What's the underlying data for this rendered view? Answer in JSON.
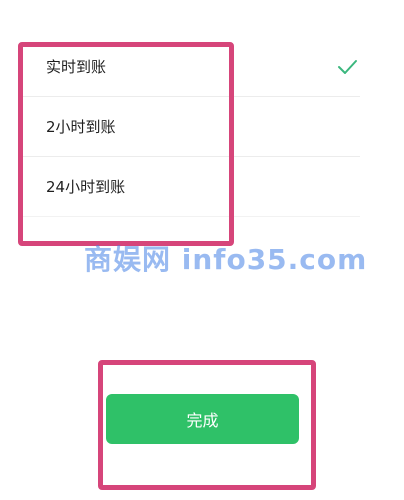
{
  "options": [
    {
      "label": "实时到账",
      "selected": true
    },
    {
      "label": "2小时到账",
      "selected": false
    },
    {
      "label": "24小时到账",
      "selected": false
    }
  ],
  "check_icon": "checkmark-icon",
  "watermark_text": "商娱网 info35.com",
  "done_button_label": "完成",
  "colors": {
    "accent_green": "#2fc168",
    "check_green": "#3bb77e",
    "highlight_border": "#d6457a",
    "watermark_blue": "#4682e6"
  }
}
